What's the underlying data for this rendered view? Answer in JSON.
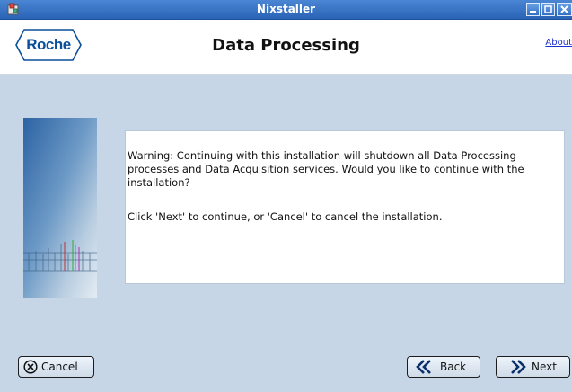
{
  "window": {
    "title": "Nixstaller",
    "icons": {
      "app": "app-icon",
      "minimize": "minimize-icon",
      "maximize": "maximize-icon",
      "close": "close-icon"
    }
  },
  "header": {
    "logo_text": "Roche",
    "page_title": "Data Processing",
    "about_label": "About"
  },
  "message": {
    "warning_text": "Warning: Continuing with this installation will shutdown all Data Processing processes and Data Acquisition services.  Would you like to continue with the installation?",
    "instruction_text": "Click 'Next' to continue, or 'Cancel' to cancel the installation."
  },
  "buttons": {
    "cancel_label": "Cancel",
    "back_label": "Back",
    "next_label": "Next",
    "icons": {
      "cancel": "cancel-x-icon",
      "back": "double-chevron-left-icon",
      "next": "double-chevron-right-icon"
    }
  },
  "colors": {
    "titlebar": "#2a63b6",
    "background": "#c6d6e6",
    "brand": "#0a4f9b",
    "link": "#1a2fd0"
  }
}
